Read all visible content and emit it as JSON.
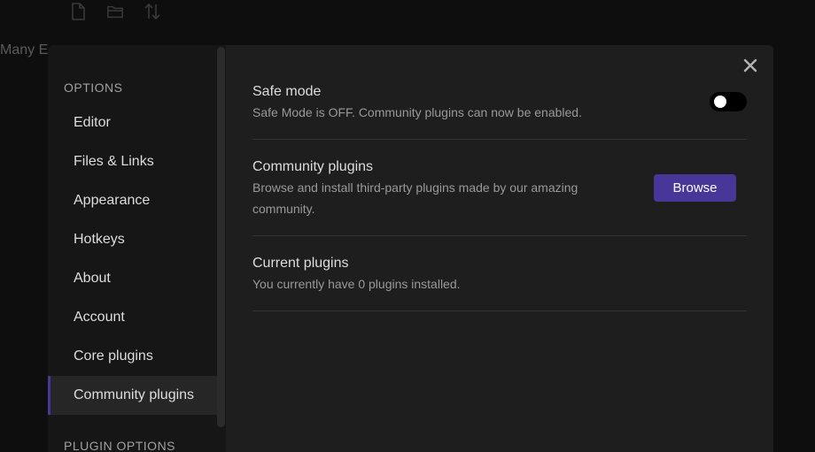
{
  "background": {
    "toolbar_icons": [
      "new-file-icon",
      "open-folder-icon",
      "sort-icon"
    ],
    "title_fragment": "Many E"
  },
  "sidebar": {
    "options_heading": "OPTIONS",
    "items": [
      {
        "label": "Editor"
      },
      {
        "label": "Files & Links"
      },
      {
        "label": "Appearance"
      },
      {
        "label": "Hotkeys"
      },
      {
        "label": "About"
      },
      {
        "label": "Account"
      },
      {
        "label": "Core plugins"
      },
      {
        "label": "Community plugins",
        "active": true
      }
    ],
    "plugin_options_heading": "PLUGIN OPTIONS"
  },
  "modal": {
    "close_icon": "close-icon"
  },
  "settings": {
    "safe_mode": {
      "name": "Safe mode",
      "desc": "Safe Mode is OFF. Community plugins can now be enabled.",
      "toggle_state": "off"
    },
    "community_plugins": {
      "name": "Community plugins",
      "desc": "Browse and install third-party plugins made by our amazing community.",
      "button_label": "Browse"
    },
    "current_plugins": {
      "name": "Current plugins",
      "desc": "You currently have 0 plugins installed."
    }
  },
  "colors": {
    "accent": "#483699",
    "modal_bg": "#1e1e1e",
    "sidebar_bg": "#161616"
  }
}
